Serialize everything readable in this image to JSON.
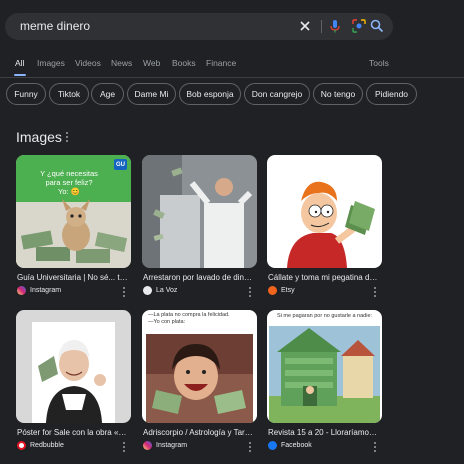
{
  "search": {
    "query": "meme dinero"
  },
  "tabs": [
    "All",
    "Images",
    "Videos",
    "News",
    "Web",
    "Books",
    "Finance"
  ],
  "tools_label": "Tools",
  "chips": [
    "Funny",
    "Tiktok",
    "Age",
    "Dame Mi",
    "Bob esponja",
    "Don cangrejo",
    "No tengo",
    "Pidiendo"
  ],
  "section": {
    "title": "Images"
  },
  "images": [
    {
      "title": "Guía Universitaria | No sé... tú ...",
      "source": "Instagram",
      "overlay": "Y ¿qué necesitas para ser feliz?\nYo: 😊",
      "badge": "GU"
    },
    {
      "title": "Arrestaron por lavado de dine...",
      "source": "La Voz"
    },
    {
      "title": "Cállate y toma mi pegatina de ...",
      "source": "Etsy"
    },
    {
      "title": "Póster for Sale con la obra «M...",
      "source": "Redbubble"
    },
    {
      "title": "Adriscorpio / Astrología y Taro...",
      "source": "Instagram",
      "overlay": "—La plata no compra la felicidad.\n—Yo con plata:"
    },
    {
      "title": "Revista 15 a 20 - Lloraríamos p...",
      "source": "Facebook",
      "overlay": "Si me pagaran por no gustarle a nadie:"
    }
  ],
  "colors": {
    "accent": "#8ab4f8",
    "instagram": "#e1306c",
    "etsy": "#f1641e",
    "redbubble": "#e41321",
    "facebook": "#1877f2"
  }
}
